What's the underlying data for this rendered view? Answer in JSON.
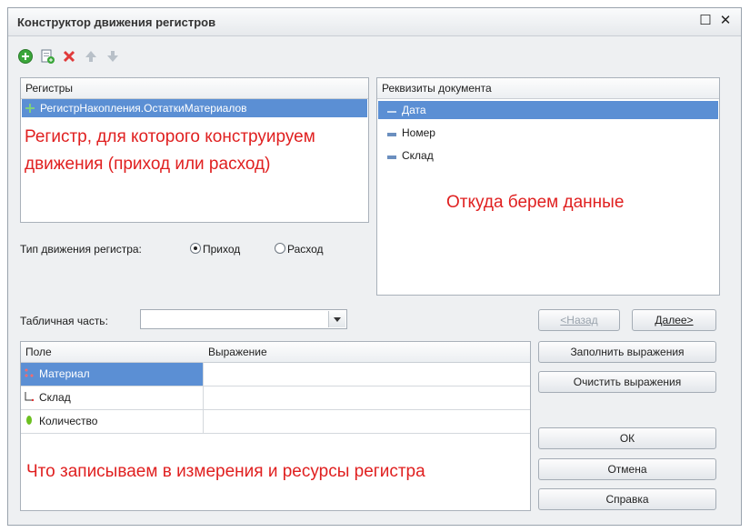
{
  "window": {
    "title": "Конструктор движения регистров"
  },
  "toolbar": {
    "icons": [
      "add-icon",
      "copy-icon",
      "delete-icon",
      "move-up-icon",
      "move-down-icon"
    ]
  },
  "registers_panel": {
    "header": "Регистры",
    "items": [
      {
        "label": "РегистрНакопления.ОстаткиМатериалов",
        "selected": true
      }
    ],
    "annotation": "Регистр, для которого конструируем движения (приход или расход)"
  },
  "movement_type": {
    "label": "Тип движения регистра:",
    "options": [
      "Приход",
      "Расход"
    ],
    "selected": "Приход"
  },
  "attributes_panel": {
    "header": "Реквизиты документа",
    "items": [
      {
        "label": "Дата",
        "selected": true
      },
      {
        "label": "Номер",
        "selected": false
      },
      {
        "label": "Склад",
        "selected": false
      }
    ],
    "annotation": "Откуда берем данные"
  },
  "tabular": {
    "label": "Табличная часть:",
    "value": ""
  },
  "nav": {
    "back": "<Назад",
    "next": "Далее>"
  },
  "table": {
    "columns": [
      "Поле",
      "Выражение"
    ],
    "rows": [
      {
        "field": "Материал",
        "expression": "",
        "selected": true,
        "icon": "dimension-icon"
      },
      {
        "field": "Склад",
        "expression": "",
        "selected": false,
        "icon": "dimension-icon"
      },
      {
        "field": "Количество",
        "expression": "",
        "selected": false,
        "icon": "resource-icon"
      }
    ],
    "annotation": "Что записываем в измерения и ресурсы регистра"
  },
  "buttons": {
    "fill": "Заполнить выражения",
    "clear": "Очистить выражения",
    "ok": "ОК",
    "cancel": "Отмена",
    "help": "Справка"
  },
  "colors": {
    "selection": "#5b8fd4",
    "annotation": "#e02020"
  }
}
